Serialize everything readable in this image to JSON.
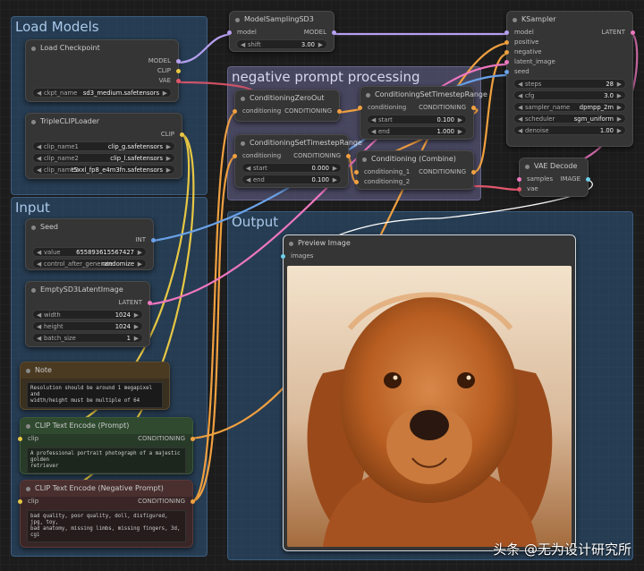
{
  "groups": {
    "load_models": "Load Models",
    "negative": "negative prompt  processing",
    "input": "Input",
    "output": "Output"
  },
  "nodes": {
    "load_checkpoint": {
      "title": "Load Checkpoint",
      "outputs": [
        "MODEL",
        "CLIP",
        "VAE"
      ],
      "ckpt_name_label": "ckpt_name",
      "ckpt_name_value": "sd3_medium.safetensors"
    },
    "triple_clip": {
      "title": "TripleCLIPLoader",
      "output": "CLIP",
      "clip1_label": "clip_name1",
      "clip1_value": "clip_g.safetensors",
      "clip2_label": "clip_name2",
      "clip2_value": "clip_l.safetensors",
      "clip3_label": "clip_name3",
      "clip3_value": "t5xxl_fp8_e4m3fn.safetensors"
    },
    "model_sampling": {
      "title": "ModelSamplingSD3",
      "input": "model",
      "output": "MODEL",
      "shift_label": "shift",
      "shift_value": "3.00"
    },
    "ksampler": {
      "title": "KSampler",
      "inputs": [
        "model",
        "positive",
        "negative",
        "latent_image",
        "seed"
      ],
      "output": "LATENT",
      "steps_label": "steps",
      "steps_value": "28",
      "cfg_label": "cfg",
      "cfg_value": "3.0",
      "sampler_label": "sampler_name",
      "sampler_value": "dpmpp_2m",
      "scheduler_label": "scheduler",
      "scheduler_value": "sgm_uniform",
      "denoise_label": "denoise",
      "denoise_value": "1.00"
    },
    "zero_out": {
      "title": "ConditioningZeroOut",
      "input": "conditioning",
      "output": "CONDITIONING"
    },
    "timestep_range_1": {
      "title": "ConditioningSetTimestepRange",
      "input": "conditioning",
      "output": "CONDITIONING",
      "start_label": "start",
      "start_value": "0.100",
      "end_label": "end",
      "end_value": "1.000"
    },
    "timestep_range_2": {
      "title": "ConditioningSetTimestepRange",
      "input": "conditioning",
      "output": "CONDITIONING",
      "start_label": "start",
      "start_value": "0.000",
      "end_label": "end",
      "end_value": "0.100"
    },
    "combine": {
      "title": "Conditioning (Combine)",
      "inputs": [
        "conditioning_1",
        "conditioning_2"
      ],
      "output": "CONDITIONING"
    },
    "vae_decode": {
      "title": "VAE Decode",
      "inputs": [
        "samples",
        "vae"
      ],
      "output": "IMAGE"
    },
    "seed": {
      "title": "Seed",
      "output": "INT",
      "value_label": "value",
      "value_value": "655893615567427",
      "control_label": "control_after_generate",
      "control_value": "randomize"
    },
    "latent": {
      "title": "EmptySD3LatentImage",
      "output": "LATENT",
      "width_label": "width",
      "width_value": "1024",
      "height_label": "height",
      "height_value": "1024",
      "batch_label": "batch_size",
      "batch_value": "1"
    },
    "note": {
      "title": "Note",
      "text": "Resolution should be around 1 megapixel and\nwidth/height must be multiple of 64"
    },
    "clip_pos": {
      "title": "CLIP Text Encode (Prompt)",
      "input": "clip",
      "output": "CONDITIONING",
      "text": "A professional portrait photograph of a majestic golden\nretriever"
    },
    "clip_neg": {
      "title": "CLIP Text Encode (Negative Prompt)",
      "input": "clip",
      "output": "CONDITIONING",
      "text": "bad quality, poor quality, doll, disfigured, jpg, toy,\nbad anatomy, missing limbs, missing fingers, 3d, cgi"
    },
    "preview": {
      "title": "Preview Image",
      "input": "images"
    }
  },
  "watermark": "头条 @无为设计研究所",
  "colors": {
    "model": "#b7a0f0",
    "clip": "#e7c744",
    "vae": "#e0566c",
    "conditioning": "#f0a040",
    "latent": "#ee77c0",
    "int": "#6aa2e8",
    "image": "#6fd0e8"
  }
}
